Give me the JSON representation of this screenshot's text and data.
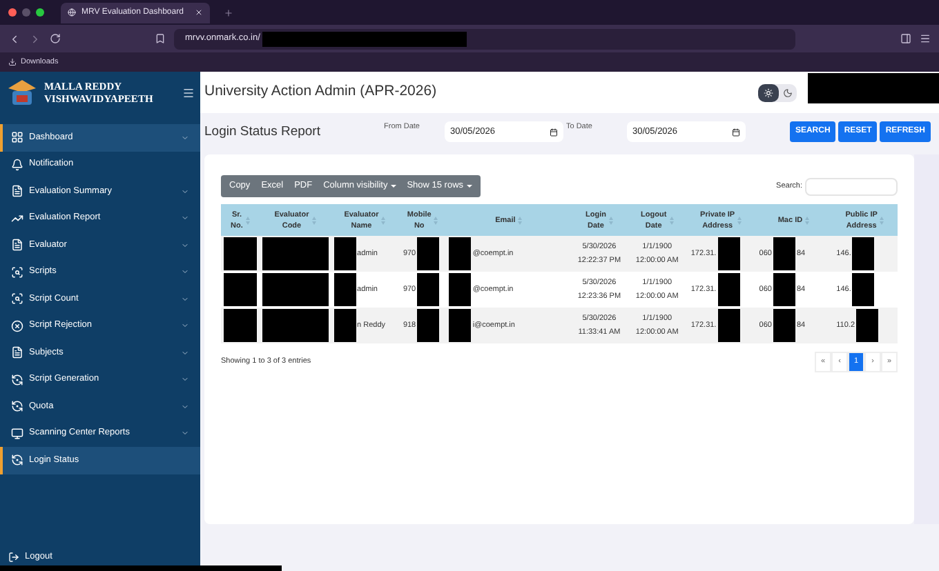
{
  "browser": {
    "tab_title": "MRV Evaluation Dashboard",
    "url": "mrvv.onmark.co.in/",
    "url_redacted": true,
    "bookmark": "Downloads"
  },
  "sidebar": {
    "brand_line_1": "MALLA REDDY",
    "brand_line_2": "VISHWAVIDYAPEETH",
    "items": [
      {
        "label": "Dashboard",
        "selected": true,
        "expandable": true
      },
      {
        "label": "Notification",
        "selected": false,
        "expandable": false
      },
      {
        "label": "Evaluation Summary",
        "selected": false,
        "expandable": true
      },
      {
        "label": "Evaluation Report",
        "selected": false,
        "expandable": true
      },
      {
        "label": "Evaluator",
        "selected": false,
        "expandable": true
      },
      {
        "label": "Scripts",
        "selected": false,
        "expandable": true
      },
      {
        "label": "Script Count",
        "selected": false,
        "expandable": true
      },
      {
        "label": "Script Rejection",
        "selected": false,
        "expandable": true
      },
      {
        "label": "Subjects",
        "selected": false,
        "expandable": true
      },
      {
        "label": "Script Generation",
        "selected": false,
        "expandable": true
      },
      {
        "label": "Quota",
        "selected": false,
        "expandable": true
      },
      {
        "label": "Scanning Center Reports",
        "selected": false,
        "expandable": true
      },
      {
        "label": "Login Status",
        "selected": true,
        "expandable": false
      }
    ],
    "logout": "Logout"
  },
  "header": {
    "title": "University Action Admin (APR-2026)",
    "dark_mode": false
  },
  "report": {
    "title": "Login Status Report",
    "from_label": "From Date",
    "from_value": "30/05/2026",
    "to_label": "To Date",
    "to_value": "30/05/2026",
    "buttons": [
      "SEARCH",
      "RESET",
      "REFRESH"
    ]
  },
  "table": {
    "toolbar": [
      {
        "label": "Copy",
        "dropdown": false
      },
      {
        "label": "Excel",
        "dropdown": false
      },
      {
        "label": "PDF",
        "dropdown": false
      },
      {
        "label": "Column visibility",
        "dropdown": true
      },
      {
        "label": "Show 15 rows",
        "dropdown": true
      }
    ],
    "search_label": "Search:",
    "columns": [
      {
        "lines": [
          "Sr.",
          "No."
        ]
      },
      {
        "lines": [
          "Evaluator",
          "Code"
        ]
      },
      {
        "lines": [
          "Evaluator",
          "Name"
        ]
      },
      {
        "lines": [
          "Mobile",
          "No"
        ]
      },
      {
        "lines": [
          "Email"
        ]
      },
      {
        "lines": [
          "Login",
          "Date"
        ]
      },
      {
        "lines": [
          "Logout",
          "Date"
        ]
      },
      {
        "lines": [
          "Private IP",
          "Address"
        ]
      },
      {
        "lines": [
          "Mac ID"
        ]
      },
      {
        "lines": [
          "Public IP",
          "Address"
        ]
      }
    ],
    "rows": [
      {
        "cells": [
          {
            "parts": [
              {
                "kind": "redaction"
              }
            ]
          },
          {
            "parts": [
              {
                "kind": "redaction"
              }
            ]
          },
          {
            "parts": [
              {
                "kind": "redaction"
              },
              {
                "kind": "text",
                "lines": [
                  "admin"
                ]
              }
            ]
          },
          {
            "parts": [
              {
                "kind": "text",
                "lines": [
                  "970"
                ]
              },
              {
                "kind": "redaction"
              }
            ]
          },
          {
            "parts": [
              {
                "kind": "redaction"
              },
              {
                "kind": "text",
                "lines": [
                  "@coempt.in"
                ]
              }
            ]
          },
          {
            "parts": [
              {
                "kind": "text",
                "lines": [
                  "5/30/2026",
                  "12:22:37 PM"
                ]
              }
            ]
          },
          {
            "parts": [
              {
                "kind": "text",
                "lines": [
                  "1/1/1900",
                  "12:00:00 AM"
                ]
              }
            ]
          },
          {
            "parts": [
              {
                "kind": "text",
                "lines": [
                  "172.31."
                ]
              },
              {
                "kind": "redaction"
              }
            ]
          },
          {
            "parts": [
              {
                "kind": "text",
                "lines": [
                  "060"
                ]
              },
              {
                "kind": "redaction"
              },
              {
                "kind": "text",
                "lines": [
                  "84"
                ]
              }
            ]
          },
          {
            "parts": [
              {
                "kind": "text",
                "lines": [
                  "146."
                ]
              },
              {
                "kind": "redaction"
              }
            ]
          }
        ]
      },
      {
        "cells": [
          {
            "parts": [
              {
                "kind": "redaction"
              }
            ]
          },
          {
            "parts": [
              {
                "kind": "redaction"
              }
            ]
          },
          {
            "parts": [
              {
                "kind": "redaction"
              },
              {
                "kind": "text",
                "lines": [
                  "admin"
                ]
              }
            ]
          },
          {
            "parts": [
              {
                "kind": "text",
                "lines": [
                  "970"
                ]
              },
              {
                "kind": "redaction"
              }
            ]
          },
          {
            "parts": [
              {
                "kind": "redaction"
              },
              {
                "kind": "text",
                "lines": [
                  "@coempt.in"
                ]
              }
            ]
          },
          {
            "parts": [
              {
                "kind": "text",
                "lines": [
                  "5/30/2026",
                  "12:23:36 PM"
                ]
              }
            ]
          },
          {
            "parts": [
              {
                "kind": "text",
                "lines": [
                  "1/1/1900",
                  "12:00:00 AM"
                ]
              }
            ]
          },
          {
            "parts": [
              {
                "kind": "text",
                "lines": [
                  "172.31."
                ]
              },
              {
                "kind": "redaction"
              }
            ]
          },
          {
            "parts": [
              {
                "kind": "text",
                "lines": [
                  "060"
                ]
              },
              {
                "kind": "redaction"
              },
              {
                "kind": "text",
                "lines": [
                  "84"
                ]
              }
            ]
          },
          {
            "parts": [
              {
                "kind": "text",
                "lines": [
                  "146."
                ]
              },
              {
                "kind": "redaction"
              }
            ]
          }
        ]
      },
      {
        "cells": [
          {
            "parts": [
              {
                "kind": "redaction"
              }
            ]
          },
          {
            "parts": [
              {
                "kind": "redaction"
              }
            ]
          },
          {
            "parts": [
              {
                "kind": "redaction"
              },
              {
                "kind": "text",
                "lines": [
                  "n Reddy"
                ]
              }
            ]
          },
          {
            "parts": [
              {
                "kind": "text",
                "lines": [
                  "918"
                ]
              },
              {
                "kind": "redaction"
              }
            ]
          },
          {
            "parts": [
              {
                "kind": "redaction"
              },
              {
                "kind": "text",
                "lines": [
                  "i@coempt.in"
                ]
              }
            ]
          },
          {
            "parts": [
              {
                "kind": "text",
                "lines": [
                  "5/30/2026",
                  "11:33:41 AM"
                ]
              }
            ]
          },
          {
            "parts": [
              {
                "kind": "text",
                "lines": [
                  "1/1/1900",
                  "12:00:00 AM"
                ]
              }
            ]
          },
          {
            "parts": [
              {
                "kind": "text",
                "lines": [
                  "172.31."
                ]
              },
              {
                "kind": "redaction"
              }
            ]
          },
          {
            "parts": [
              {
                "kind": "text",
                "lines": [
                  "060"
                ]
              },
              {
                "kind": "redaction"
              },
              {
                "kind": "text",
                "lines": [
                  "84"
                ]
              }
            ]
          },
          {
            "parts": [
              {
                "kind": "text",
                "lines": [
                  "110.2"
                ]
              },
              {
                "kind": "redaction"
              }
            ]
          }
        ]
      }
    ],
    "info": "Showing 1 to 3 of 3 entries",
    "pager": [
      {
        "label": "«",
        "selected": false
      },
      {
        "label": "‹",
        "selected": false
      },
      {
        "label": "1",
        "selected": true
      },
      {
        "label": "›",
        "selected": false
      },
      {
        "label": "»",
        "selected": false
      }
    ]
  }
}
